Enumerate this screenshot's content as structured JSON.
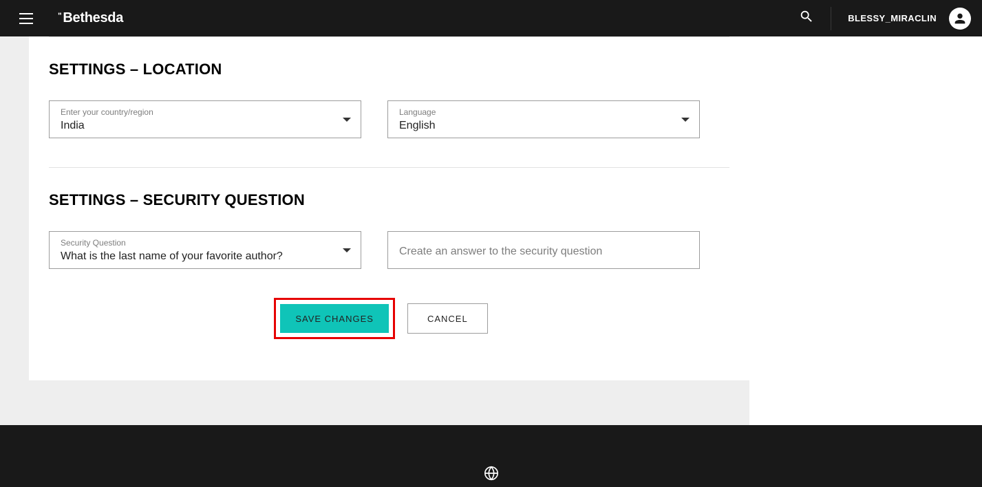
{
  "header": {
    "logo_text": "Bethesda",
    "username": "BLESSY_MIRACLIN"
  },
  "sections": {
    "location": {
      "title": "SETTINGS – LOCATION",
      "country_label": "Enter your country/region",
      "country_value": "India",
      "language_label": "Language",
      "language_value": "English"
    },
    "security": {
      "title": "SETTINGS – SECURITY QUESTION",
      "question_label": "Security Question",
      "question_value": "What is the last name of your favorite author?",
      "answer_placeholder": "Create an answer to the security question"
    }
  },
  "buttons": {
    "save": "SAVE CHANGES",
    "cancel": "CANCEL"
  }
}
